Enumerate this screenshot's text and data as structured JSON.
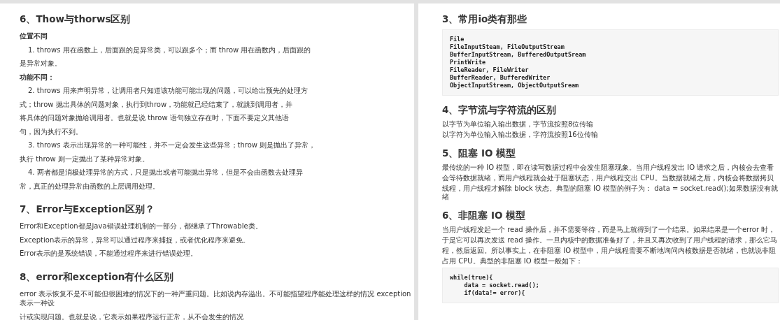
{
  "pages": [
    {
      "sections": [
        {
          "heading": "6、Thow与thorws区别",
          "blocks": [
            {
              "kind": "label",
              "lines": [
                "位置不同"
              ]
            },
            {
              "kind": "item",
              "lines": [
                "1. throws 用在函数上，后面跟的是异常类，可以跟多个；而 throw 用在函数内，后面跟的",
                "是异常对象。"
              ]
            },
            {
              "kind": "label",
              "lines": [
                "功能不同："
              ]
            },
            {
              "kind": "item",
              "lines": [
                "2. throws 用来声明异常，让调用者只知道该功能可能出现的问题，可以给出预先的处理方",
                "式；throw 抛出具体的问题对象，执行到throw，功能就已经结束了，就跳到调用者，并",
                "将具体的问题对象抛给调用者。也就是说 throw 语句独立存在时，下面不要定义其他语",
                "句，因为执行不到。"
              ]
            },
            {
              "kind": "item",
              "lines": [
                "3. throws 表示出现异常的一种可能性，并不一定会发生这些异常；throw 则是抛出了异常，",
                "执行 throw 则一定抛出了某种异常对象。"
              ]
            },
            {
              "kind": "item",
              "lines": [
                "4. 两者都是消极处理异常的方式，只是抛出或者可能抛出异常，但是不会由函数去处理异",
                "常，真正的处理异常由函数的上层调用处理。"
              ]
            }
          ]
        },
        {
          "heading": "7、Error与Exception区别？",
          "blocks": [
            {
              "kind": "para",
              "lines": [
                "Error和Exception都是java错误处理机制的一部分，都继承了Throwable类。"
              ]
            },
            {
              "kind": "para",
              "lines": [
                "Exception表示的异常，异常可以通过程序来捕捉，或者优化程序来避免。"
              ]
            },
            {
              "kind": "para",
              "lines": [
                "Error表示的是系统错误，不能通过程序来进行错误处理。"
              ]
            }
          ]
        },
        {
          "heading": "8、error和exception有什么区别",
          "blocks": [
            {
              "kind": "para",
              "lines": [
                "error 表示恢复不是不可能但很困难的情况下的一种严重问题。比如说内存溢出。不可能指望程序能处理这样的情况 exception 表示一种设",
                "计或实现问题。也就是说，它表示如果程序运行正常，从不会发生的情况"
              ]
            }
          ]
        }
      ]
    },
    {
      "sections": [
        {
          "heading": "3、常用io类有那些",
          "blocks": [
            {
              "kind": "code",
              "lines": [
                "File",
                "FileInputSteam, FileOutputStream",
                "BufferInputStream, BufferedOutputSream",
                "PrintWrite",
                "FileReader, FileWriter",
                "BufferReader, BufferedWriter",
                "ObjectInputStream, ObjectOutputSream"
              ]
            }
          ]
        },
        {
          "heading": "4、字节流与字符流的区别",
          "blocks": [
            {
              "kind": "para",
              "lines": [
                "以字节为单位输入输出数据，字节流按照8位传输",
                "以字符为单位输入输出数据，字符流按照16位传输"
              ]
            }
          ]
        },
        {
          "heading": "5、阻塞 IO 模型",
          "blocks": [
            {
              "kind": "para",
              "lines": [
                "最传统的一种 IO 模型，即在读写数据过程中会发生阻塞现象。当用户线程发出 IO 请求之后，内核会去查看",
                "会等待数据就绪，而用户线程就会处于阻塞状态，用户线程交出 CPU。当数据就绪之后，内核会将数据拷贝",
                "线程，用户线程才解除 block 状态。典型的阻塞 IO 模型的例子为： data = socket.read();如果数据没有就绪"
              ]
            }
          ]
        },
        {
          "heading": "6、非阻塞 IO 模型",
          "blocks": [
            {
              "kind": "para",
              "lines": [
                "当用户线程发起一个 read 操作后，并不需要等待，而是马上就得到了一个结果。如果结果是一个error 时，",
                "于是它可以再次发送 read 操作。一旦内核中的数据准备好了，并且又再次收到了用户线程的请求，那么它马",
                "程，然后返回。所以事实上，在非阻塞 IO 模型中，用户线程需要不断地询问内核数据是否就绪，也就说非阻",
                "占用 CPU。典型的非阻塞 IO 模型一般如下："
              ]
            },
            {
              "kind": "code",
              "lines": [
                "while(true){",
                "    data = socket.read();",
                "    if(data!= error){"
              ]
            }
          ]
        }
      ]
    }
  ]
}
